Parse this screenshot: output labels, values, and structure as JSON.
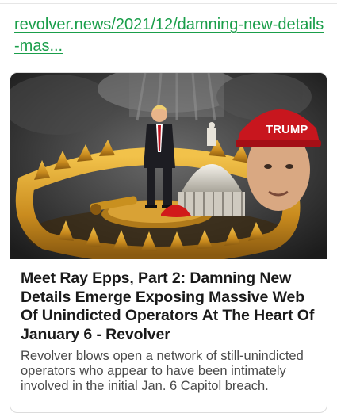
{
  "link": {
    "text": "revolver.news/2021/12/damning-new-details-mas..."
  },
  "card": {
    "title": "Meet Ray Epps, Part 2: Damning New Details Emerge Exposing Massive Web Of Unindicted Operators At The Heart Of January 6 - Revolver",
    "description": "Revolver blows open a network of still-unindicted operators who appear to have been intimately involved in the initial Jan. 6 Capitol breach.",
    "image_text": {
      "hat_text": "TRUMP"
    }
  },
  "colors": {
    "link": "#1a9e4a",
    "title": "#1a1a1a",
    "description": "#4a4a4a",
    "card_border": "#dcdcdc"
  }
}
